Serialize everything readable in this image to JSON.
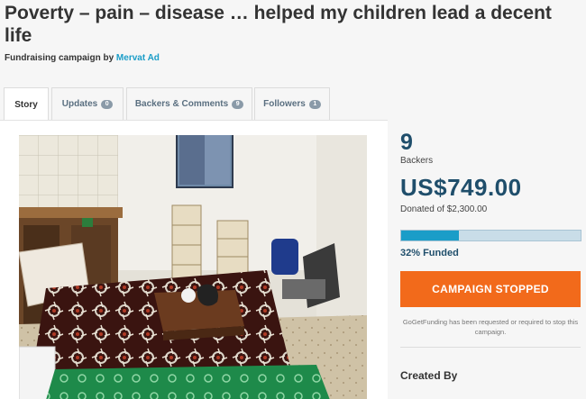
{
  "campaign": {
    "title": "Poverty – pain – disease … helped my children lead a decent life",
    "byline_prefix": "Fundraising campaign by",
    "author": "Mervat Ad"
  },
  "tabs": [
    {
      "label": "Story",
      "count": null,
      "active": true
    },
    {
      "label": "Updates",
      "count": "0",
      "active": false
    },
    {
      "label": "Backers & Comments",
      "count": "9",
      "active": false
    },
    {
      "label": "Followers",
      "count": "1",
      "active": false
    }
  ],
  "stats": {
    "backers_count": "9",
    "backers_label": "Backers",
    "amount": "US$749.00",
    "target": "Donated of $2,300.00",
    "funded_fraction": 0.32,
    "funded_label": "32% Funded"
  },
  "campaign_button": {
    "label": "CAMPAIGN STOPPED"
  },
  "stop_note": "GoGetFunding has been requested or required to stop this campaign.",
  "created_by_heading": "Created By",
  "colors": {
    "accent_orange": "#f26a1b",
    "brand_blue": "#1f4e6b",
    "link_blue": "#1a9dc8"
  }
}
